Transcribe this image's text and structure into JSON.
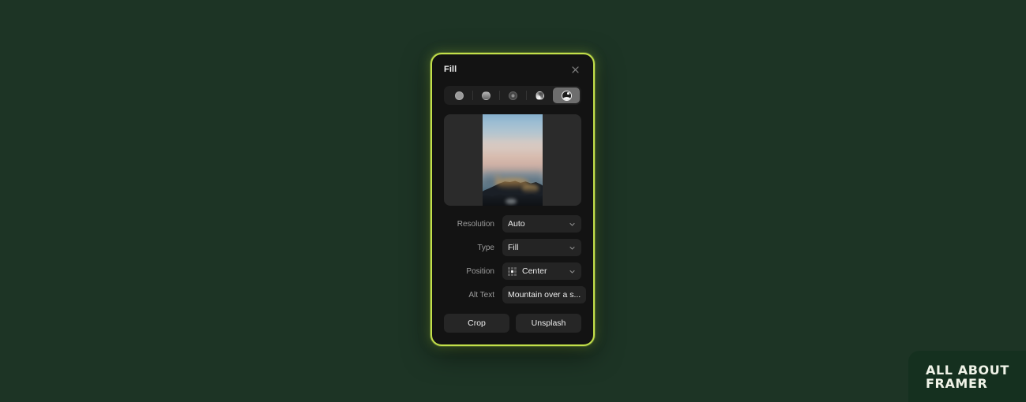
{
  "background_color": "#1d3425",
  "panel": {
    "title": "Fill",
    "border_color": "#c3e04a",
    "close_icon": "close-icon",
    "fill_types": [
      {
        "id": "solid",
        "label": "Solid Color",
        "icon": "solid-circle-icon",
        "selected": false
      },
      {
        "id": "linear",
        "label": "Linear Gradient",
        "icon": "linear-gradient-icon",
        "selected": false
      },
      {
        "id": "radial",
        "label": "Radial Gradient",
        "icon": "radial-gradient-icon",
        "selected": false
      },
      {
        "id": "angular",
        "label": "Angular Gradient",
        "icon": "angular-gradient-icon",
        "selected": false
      },
      {
        "id": "image",
        "label": "Image",
        "icon": "image-icon",
        "selected": true
      }
    ],
    "preview": {
      "name": "image-preview",
      "description": "Mountain landscape at dusk with pink clouds"
    },
    "fields": [
      {
        "name": "resolution",
        "label": "Resolution",
        "value": "Auto",
        "control": "select",
        "chevron": "chevron-down-icon"
      },
      {
        "name": "type",
        "label": "Type",
        "value": "Fill",
        "control": "select",
        "chevron": "chevron-down-icon"
      },
      {
        "name": "position",
        "label": "Position",
        "value": "Center",
        "control": "select",
        "icon": "position-grid-icon",
        "grid_selected_index": 4,
        "chevron": "chevron-down-icon"
      },
      {
        "name": "alt-text",
        "label": "Alt Text",
        "value": "Mountain over a s...",
        "control": "text"
      }
    ],
    "actions": [
      {
        "name": "crop",
        "label": "Crop"
      },
      {
        "name": "unsplash",
        "label": "Unsplash"
      }
    ]
  },
  "watermark": {
    "line1": "ALL ABOUT",
    "line2": "FRAMER",
    "background_color": "#15301f"
  }
}
